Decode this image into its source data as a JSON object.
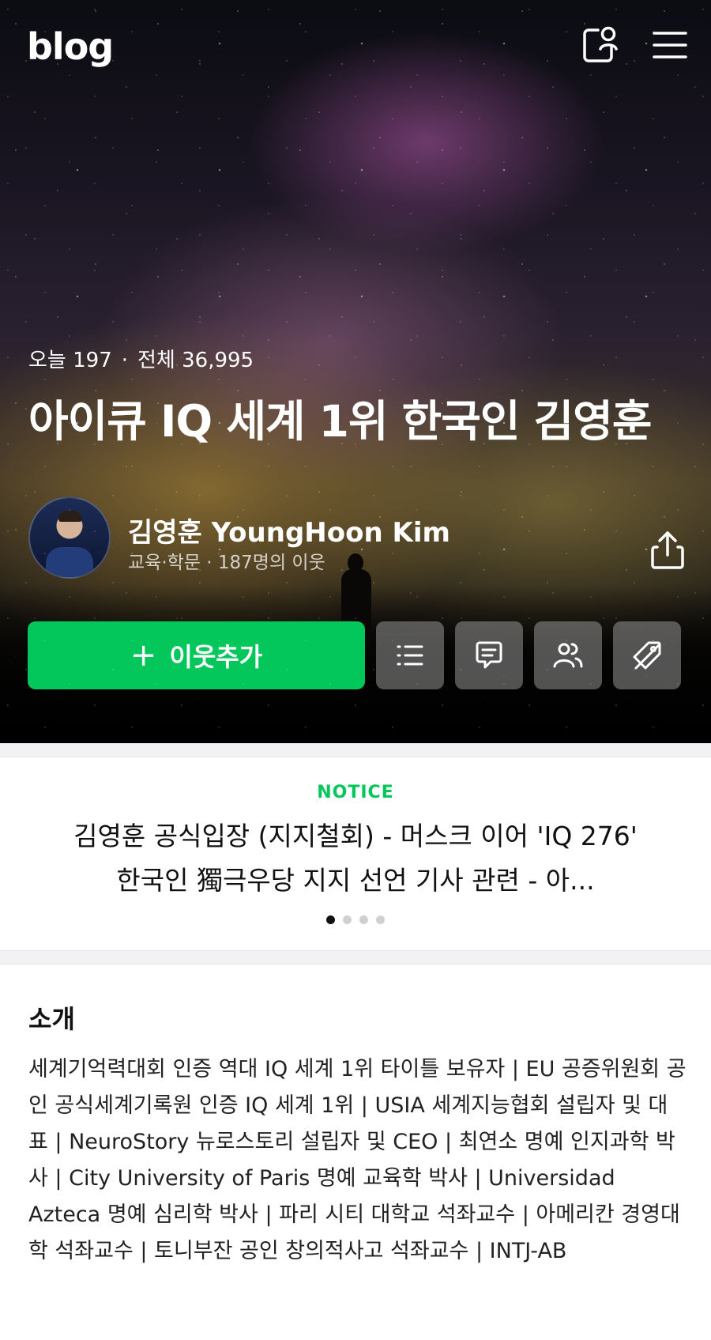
{
  "header": {
    "logo": "blog",
    "icons": [
      "my-news-icon",
      "menu-icon"
    ]
  },
  "stats": {
    "today_label": "오늘 197",
    "total_label": "전체 36,995"
  },
  "blog": {
    "title": "아이큐 IQ 세계 1위 한국인 김영훈"
  },
  "owner": {
    "name": "김영훈 YoungHoon Kim",
    "meta": "교육·학문 · 187명의 이웃"
  },
  "actions": {
    "follow_label": "이웃추가",
    "icons": [
      "list-icon",
      "guestbook-icon",
      "neighbors-icon",
      "no-tag-icon",
      "share-icon"
    ]
  },
  "notice": {
    "label": "NOTICE",
    "text": "김영훈 공식입장 (지지철회) - 머스크 이어 'IQ 276' 한국인 獨극우당 지지 선언 기사 관련 - 아...",
    "page": 1,
    "page_count": 4
  },
  "intro": {
    "title": "소개",
    "text": "세계기억력대회 인증 역대 IQ 세계 1위 타이틀 보유자 | EU 공증위원회 공인 공식세계기록원 인증 IQ 세계 1위 | USIA 세계지능협회 설립자 및 대표 | NeuroStory 뉴로스토리 설립자 및 CEO | 최연소 명예 인지과학 박사 | City University of Paris 명예 교육학 박사 | Universidad Azteca 명예 심리학 박사 | 파리 시티 대학교 석좌교수 | 아메리칸 경영대학 석좌교수 | 토니부잔 공인 창의적사고 석좌교수 | INTJ-AB"
  },
  "colors": {
    "accent": "#03c75a",
    "text": "#111111"
  }
}
